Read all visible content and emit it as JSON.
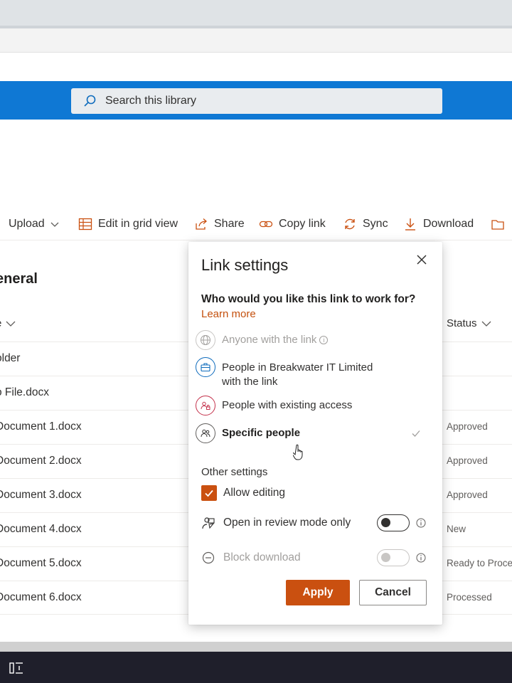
{
  "search": {
    "placeholder": "Search this library"
  },
  "commands": {
    "upload": "Upload",
    "edit_grid": "Edit in grid view",
    "share": "Share",
    "copy_link": "Copy link",
    "sync": "Sync",
    "download": "Download"
  },
  "library": {
    "title": "eneral"
  },
  "columns": {
    "name": "e",
    "status": "Status"
  },
  "rows": [
    {
      "name": "older",
      "status": ""
    },
    {
      "name": "o File.docx",
      "status": ""
    },
    {
      "name": "Document 1.docx",
      "status": "Approved"
    },
    {
      "name": "Document 2.docx",
      "status": "Approved"
    },
    {
      "name": "Document 3.docx",
      "status": "Approved"
    },
    {
      "name": "Document 4.docx",
      "status": "New"
    },
    {
      "name": "Document 5.docx",
      "status": "Ready to Proces"
    },
    {
      "name": "Document 6.docx",
      "status": "Processed"
    }
  ],
  "dialog": {
    "title": "Link settings",
    "question": "Who would you like this link to work for?",
    "learn_more": "Learn more",
    "options": [
      {
        "label": "Anyone with the link",
        "icon": "globe-icon",
        "state": "disabled"
      },
      {
        "label_line1": "People in Breakwater IT Limited",
        "label_line2": "with the link",
        "icon": "briefcase-icon",
        "state": "enabled"
      },
      {
        "label": "People with existing access",
        "icon": "people-lock-icon",
        "state": "enabled"
      },
      {
        "label": "Specific people",
        "icon": "people-icon",
        "state": "selected"
      }
    ],
    "other_settings": "Other settings",
    "allow_editing": {
      "label": "Allow editing",
      "checked": true
    },
    "review_mode": {
      "label": "Open in review mode only",
      "on": false
    },
    "block_download": {
      "label": "Block download",
      "on": false,
      "disabled": true
    },
    "apply": "Apply",
    "cancel": "Cancel"
  },
  "colors": {
    "suite_bar": "#0f78d4",
    "accent": "#ca5010",
    "taskbar": "#1f1f2b"
  }
}
